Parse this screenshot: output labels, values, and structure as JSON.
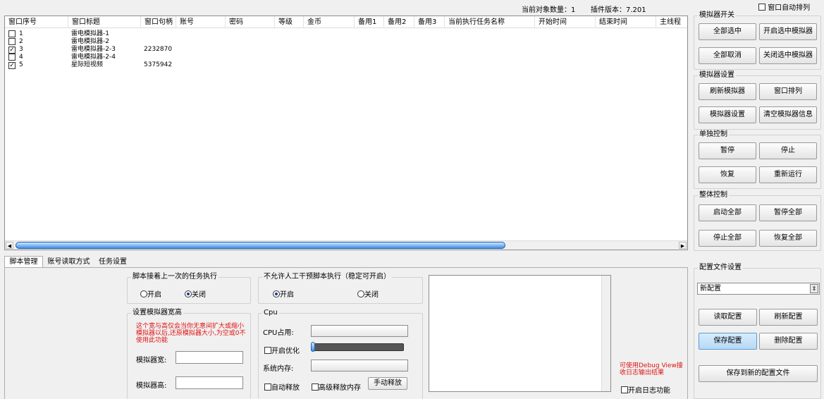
{
  "top_bar": {
    "count_label": "当前对象数量：1",
    "version_label": "插件版本：7.201",
    "auto_arrange_label": "窗口自动排列"
  },
  "table": {
    "columns": [
      "窗口序号",
      "窗口标题",
      "窗口句柄",
      "账号",
      "密码",
      "等级",
      "金币",
      "备用1",
      "备用2",
      "备用3",
      "当前执行任务名称",
      "开始时间",
      "结束时间",
      "主线程"
    ],
    "rows": [
      {
        "id": "1",
        "title": "雷电模拟器-1",
        "handle": "",
        "checked": false
      },
      {
        "id": "2",
        "title": "雷电模拟器-2",
        "handle": "",
        "checked": false
      },
      {
        "id": "3",
        "title": "雷电模拟器-2-3",
        "handle": "2232870",
        "checked": true
      },
      {
        "id": "4",
        "title": "雷电模拟器-2-4",
        "handle": "",
        "checked": false
      },
      {
        "id": "5",
        "title": "星际短视频",
        "handle": "5375942",
        "checked": true
      }
    ]
  },
  "right_panel": {
    "sim_switch": {
      "title": "模拟器开关",
      "select_all": "全部选中",
      "open_selected": "开启选中模拟器",
      "cancel_all": "全部取消",
      "close_selected": "关闭选中模拟器"
    },
    "sim_settings": {
      "title": "模拟器设置",
      "refresh": "刷新模拟器",
      "arrange": "窗口排列",
      "settings": "模拟器设置",
      "clear": "清空模拟器信息"
    },
    "single": {
      "title": "单独控制",
      "pause": "暂停",
      "stop": "停止",
      "resume": "恢复",
      "rerun": "重新运行"
    },
    "overall": {
      "title": "整体控制",
      "start_all": "启动全部",
      "pause_all": "暂停全部",
      "stop_all": "停止全部",
      "resume_all": "恢复全部"
    },
    "config": {
      "title": "配置文件设置",
      "selected": "新配置",
      "read": "读取配置",
      "refresh": "刷新配置",
      "save": "保存配置",
      "delete": "删除配置",
      "save_new": "保存到新的配置文件"
    }
  },
  "tabs": [
    "脚本管理",
    "账号读取方式",
    "任务设置"
  ],
  "script_mgmt": {
    "continue_group": {
      "title": "脚本接着上一次的任务执行",
      "on": "开启",
      "off": "关闭",
      "selected": "off"
    },
    "no_manual_group": {
      "title": "不允许人工干预脚本执行（稳定可开启）",
      "on": "开启",
      "off": "关闭",
      "selected": "on"
    },
    "size_group": {
      "title": "设置模拟器宽高",
      "warning": "这个宽与高仅会当你无意间扩大或缩小模拟器以后,还原模拟器大小,为空或0不使用此功能",
      "width_label": "模拟器宽:",
      "height_label": "模拟器高:",
      "width_value": "",
      "height_value": ""
    },
    "cpu_group": {
      "title": "Cpu",
      "cpu_usage": "CPU占用:",
      "enable_opt": "开启优化",
      "sys_mem": "系统内存:",
      "auto_release": "自动释放",
      "adv_release": "高级释放内存",
      "manual_release": "手动释放"
    },
    "debug_hint": "可使用Debug View接收日志输出结果",
    "enable_log": "开启日志功能"
  },
  "colors": {
    "accent_blue": "#3d8ee8",
    "warning_red": "#e01010"
  }
}
